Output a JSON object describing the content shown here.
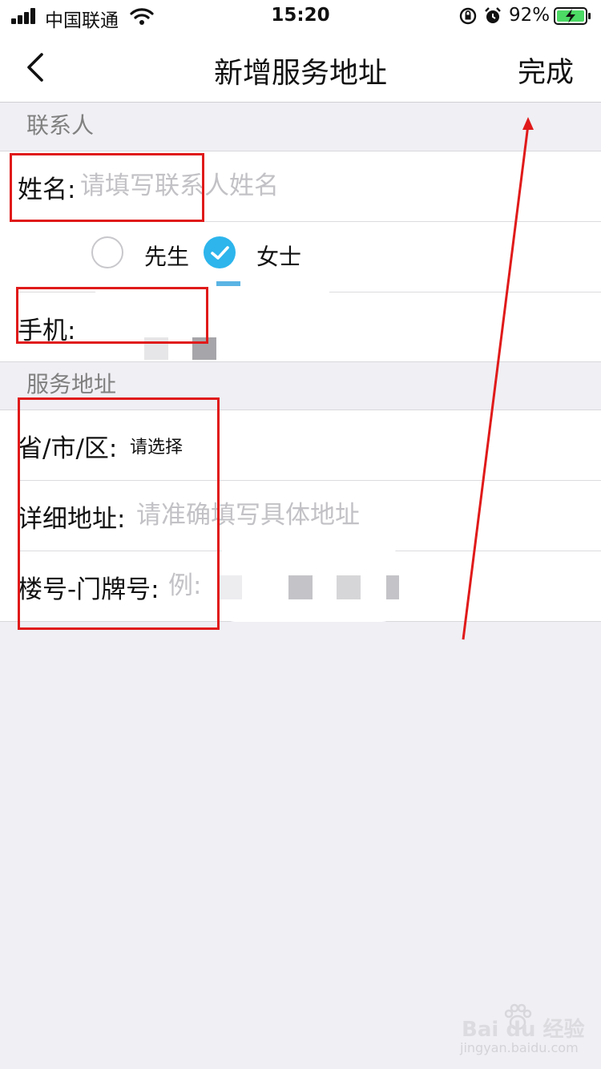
{
  "status_bar": {
    "carrier": "中国联通",
    "time": "15:20",
    "battery_percent": "92%",
    "icons": [
      "signal-icon",
      "wifi-icon",
      "orientation-lock-icon",
      "alarm-icon",
      "battery-charging-icon"
    ]
  },
  "navbar": {
    "back_icon": "chevron-left-icon",
    "title": "新增服务地址",
    "done_label": "完成"
  },
  "contact_section": {
    "header": "联系人",
    "name_label": "姓名:",
    "name_placeholder": "请填写联系人姓名",
    "name_value": "",
    "gender_options": [
      {
        "label": "先生",
        "selected": false
      },
      {
        "label": "女士",
        "selected": true
      }
    ],
    "phone_label": "手机:",
    "phone_value": ""
  },
  "address_section": {
    "header": "服务地址",
    "region_label": "省/市/区:",
    "region_value": "请选择",
    "detail_label": "详细地址:",
    "detail_placeholder": "请准确填写具体地址",
    "building_label": "楼号-门牌号:",
    "building_placeholder": "例:"
  },
  "watermark": {
    "logo_text": "Bai du 经验",
    "url_text": "jingyan.baidu.com"
  },
  "colors": {
    "accent": "#2db5ec",
    "annotation": "#e01a1a",
    "background": "#efeff4",
    "placeholder": "#c2c2c6"
  }
}
